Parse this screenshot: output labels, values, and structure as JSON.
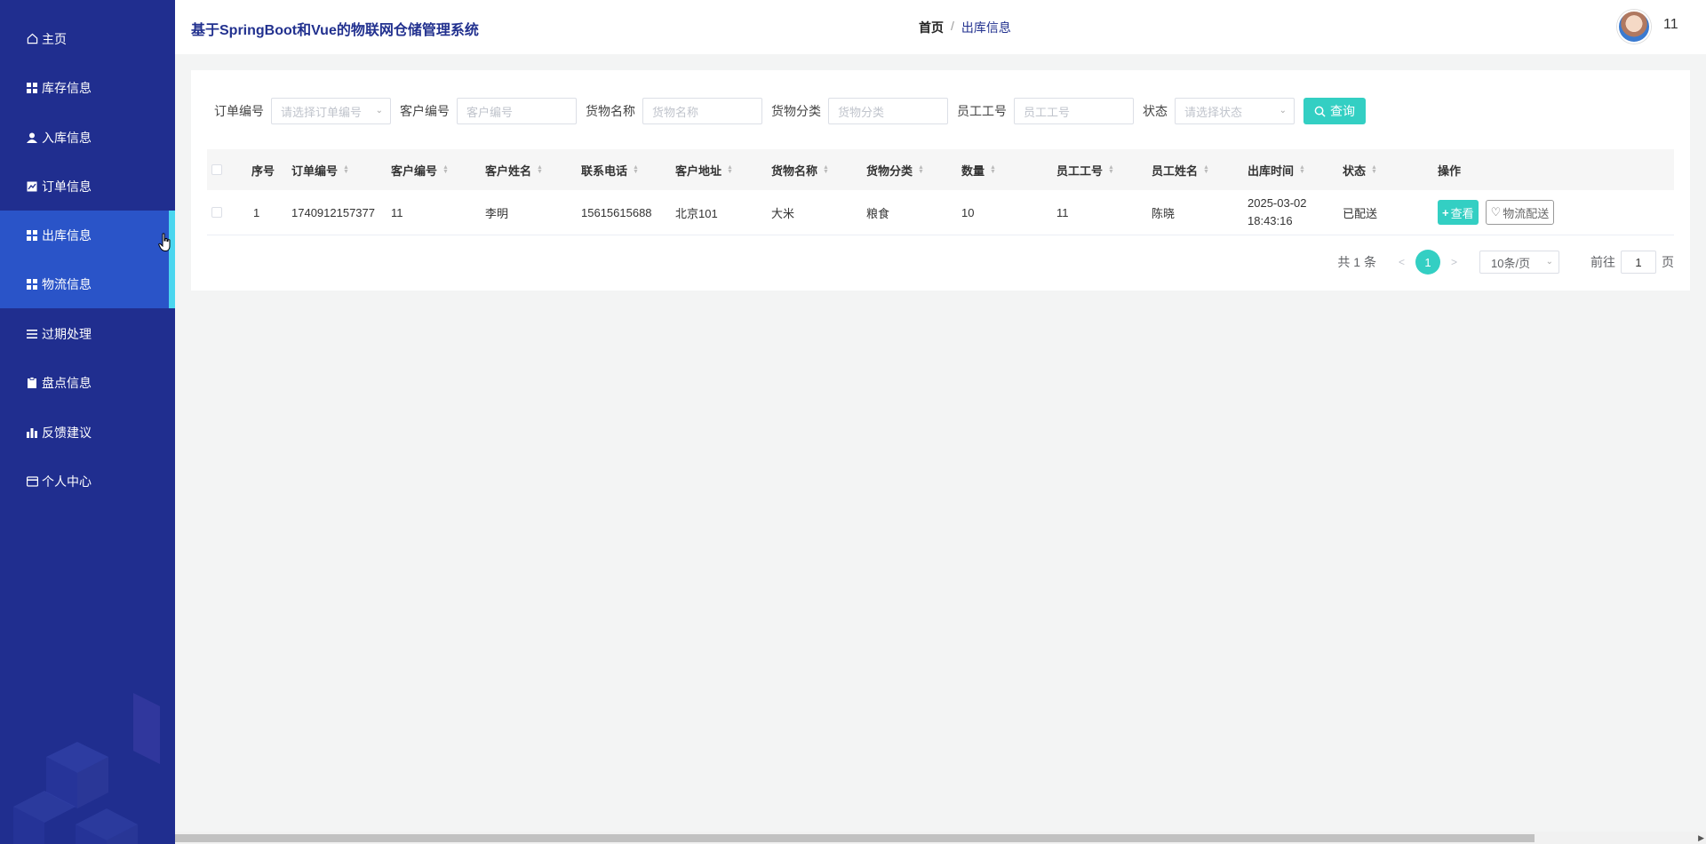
{
  "sidebar": {
    "items": [
      {
        "label": "主页",
        "icon": "home-icon",
        "active": false
      },
      {
        "label": "库存信息",
        "icon": "grid-icon",
        "active": false
      },
      {
        "label": "入库信息",
        "icon": "user-icon",
        "active": false
      },
      {
        "label": "订单信息",
        "icon": "chart-box-icon",
        "active": false
      },
      {
        "label": "出库信息",
        "icon": "grid-icon",
        "active": true
      },
      {
        "label": "物流信息",
        "icon": "grid-icon",
        "active": true
      },
      {
        "label": "过期处理",
        "icon": "list-icon",
        "active": false
      },
      {
        "label": "盘点信息",
        "icon": "clipboard-icon",
        "active": false
      },
      {
        "label": "反馈建议",
        "icon": "bar-chart-icon",
        "active": false
      },
      {
        "label": "个人中心",
        "icon": "card-icon",
        "active": false
      }
    ]
  },
  "header": {
    "title": "基于SpringBoot和Vue的物联网仓储管理系统",
    "breadcrumb_home": "首页",
    "breadcrumb_sep": "/",
    "breadcrumb_current": "出库信息",
    "username": "11"
  },
  "filters": {
    "order_no": {
      "label": "订单编号",
      "placeholder": "请选择订单编号"
    },
    "customer_no": {
      "label": "客户编号",
      "placeholder": "客户编号"
    },
    "goods_name": {
      "label": "货物名称",
      "placeholder": "货物名称"
    },
    "goods_category": {
      "label": "货物分类",
      "placeholder": "货物分类"
    },
    "staff_no": {
      "label": "员工工号",
      "placeholder": "员工工号"
    },
    "status": {
      "label": "状态",
      "placeholder": "请选择状态"
    },
    "search_label": "查询"
  },
  "table": {
    "columns": [
      "序号",
      "订单编号",
      "客户编号",
      "客户姓名",
      "联系电话",
      "客户地址",
      "货物名称",
      "货物分类",
      "数量",
      "员工工号",
      "员工姓名",
      "出库时间",
      "状态",
      "操作"
    ],
    "rows": [
      {
        "index": "1",
        "order_no": "1740912157377",
        "customer_no": "11",
        "customer_name": "李明",
        "phone": "15615615688",
        "address": "北京101",
        "goods_name": "大米",
        "goods_category": "粮食",
        "quantity": "10",
        "staff_no": "11",
        "staff_name": "陈晓",
        "out_time": "2025-03-02 18:43:16",
        "status": "已配送",
        "view_label": "查看",
        "logistics_label": "物流配送"
      }
    ]
  },
  "pagination": {
    "total_text": "共 1 条",
    "prev": "<",
    "current_page": "1",
    "next": ">",
    "page_size": "10条/页",
    "goto_prefix": "前往",
    "goto_value": "1",
    "goto_suffix": "页"
  },
  "colors": {
    "sidebar_bg": "#202e8f",
    "sidebar_active": "#2a54c8",
    "accent": "#33cfc3",
    "active_bar": "#4ad6ef"
  }
}
